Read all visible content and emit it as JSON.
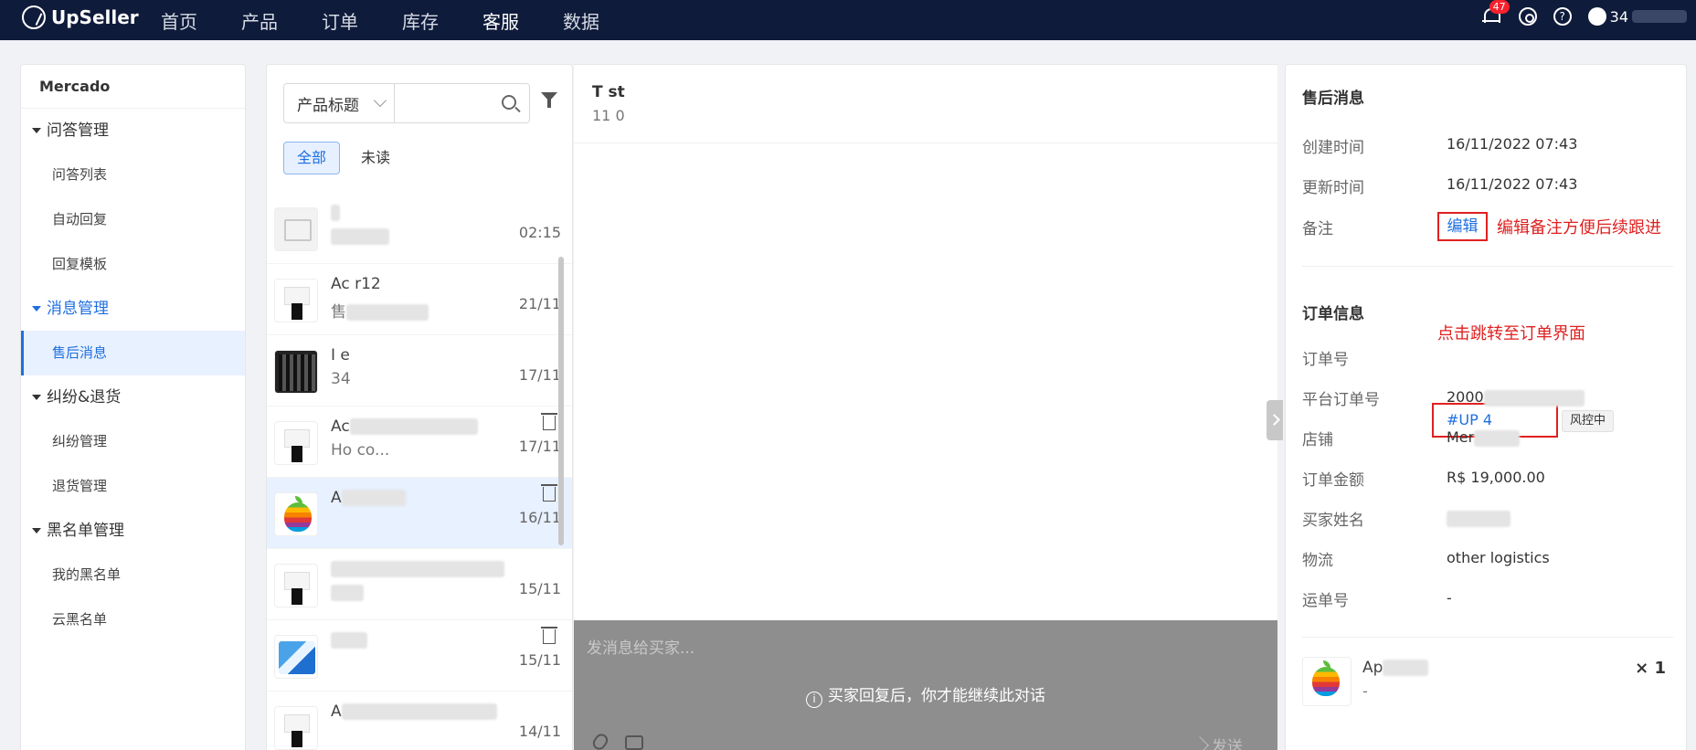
{
  "topbar": {
    "logo": "UpSeller",
    "nav": [
      "首页",
      "产品",
      "订单",
      "库存",
      "客服",
      "数据"
    ],
    "active_nav": "客服",
    "notification_count": "47",
    "user_text": "34"
  },
  "sidebar": {
    "title": "Mercado",
    "groups": [
      {
        "label": "问答管理",
        "items": [
          "问答列表",
          "自动回复",
          "回复模板"
        ]
      },
      {
        "label": "消息管理",
        "items": [
          "售后消息"
        ]
      },
      {
        "label": "纠纷&退货",
        "items": [
          "纠纷管理",
          "退货管理"
        ]
      },
      {
        "label": "黑名单管理",
        "items": [
          "我的黑名单",
          "云黑名单"
        ]
      }
    ],
    "active_group": "消息管理",
    "active_item": "售后消息"
  },
  "conversations": {
    "search": {
      "select_label": "产品标题",
      "placeholder": ""
    },
    "tabs": [
      "全部",
      "未读"
    ],
    "active_tab": "全部",
    "items": [
      {
        "name": "",
        "sub": "",
        "time": "02:15",
        "thumb": "placeholder-icon",
        "trash": false
      },
      {
        "name": "Ac            r12",
        "sub": "售",
        "time": "21/11",
        "thumb": "outfit",
        "trash": false
      },
      {
        "name": "I       e",
        "sub": "34",
        "time": "17/11",
        "thumb": "dark",
        "trash": false
      },
      {
        "name": "Ac",
        "sub": "Ho            co...",
        "time": "17/11",
        "thumb": "outfit",
        "trash": true
      },
      {
        "name": "A",
        "sub": "",
        "time": "16/11",
        "thumb": "apple-logo",
        "trash": true,
        "active": true
      },
      {
        "name": "",
        "sub": "",
        "time": "15/11",
        "thumb": "outfit",
        "trash": false
      },
      {
        "name": "",
        "sub": "",
        "time": "15/11",
        "thumb": "box",
        "trash": true
      },
      {
        "name": "A",
        "sub": "",
        "time": "14/11",
        "thumb": "outfit",
        "trash": false
      }
    ]
  },
  "chat": {
    "title": "T       st",
    "subtitle": "11        0",
    "input_placeholder": "发消息给买家...",
    "notice": "买家回复后，你才能继续此对话",
    "send_label": "发送"
  },
  "detail": {
    "after_sale_title": "售后消息",
    "created_label": "创建时间",
    "created_value": "16/11/2022 07:43",
    "updated_label": "更新时间",
    "updated_value": "16/11/2022 07:43",
    "note_label": "备注",
    "edit_label": "编辑",
    "edit_annotation": "编辑备注方便后续跟进",
    "order_title": "订单信息",
    "order_annotation": "点击跳转至订单界面",
    "order_no_label": "订单号",
    "order_no_value": "#UP         4",
    "risk_tag": "风控中",
    "platform_no_label": "平台订单号",
    "platform_no_value": "2000",
    "store_label": "店铺",
    "store_value": "Mer",
    "amount_label": "订单金额",
    "amount_value": "R$ 19,000.00",
    "buyer_label": "买家姓名",
    "buyer_value": "",
    "logistics_label": "物流",
    "logistics_value": "other logistics",
    "tracking_label": "运单号",
    "tracking_value": "-",
    "product_name": "Ap",
    "product_sub": "-",
    "product_qty": "× 1"
  },
  "colors": {
    "topbar": "#0f1b3a",
    "accent": "#1f6fe0",
    "annotation_red": "#e02020",
    "disabled_overlay": "#8e8e8e"
  }
}
